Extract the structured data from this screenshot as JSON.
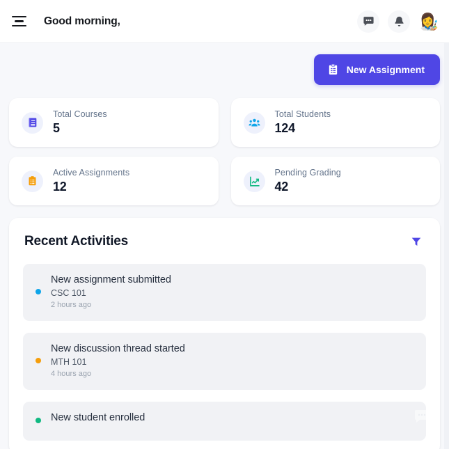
{
  "topbar": {
    "menu_icon": "hamburger-icon",
    "greeting": "Good morning,",
    "messages_icon": "chat-bubble-icon",
    "notifications_icon": "bell-icon",
    "avatar_emoji": "👩‍🎨"
  },
  "toolbar": {
    "new_assignment_label": "New Assignment",
    "new_assignment_icon": "clipboard-icon",
    "accent_color": "#4f46e5"
  },
  "stats": [
    {
      "label": "Total Courses",
      "value": "5",
      "icon": "book-icon",
      "icon_color": "#4f46e5"
    },
    {
      "label": "Total Students",
      "value": "124",
      "icon": "users-icon",
      "icon_color": "#0ea5e9"
    },
    {
      "label": "Active Assignments",
      "value": "12",
      "icon": "clipboard-list-icon",
      "icon_color": "#f59e0b"
    },
    {
      "label": "Pending Grading",
      "value": "42",
      "icon": "chart-line-icon",
      "icon_color": "#10b981"
    }
  ],
  "activities_panel": {
    "title": "Recent Activities",
    "filter_icon": "filter-icon",
    "filter_color": "#4f46e5",
    "items": [
      {
        "title": "New assignment submitted",
        "course": "CSC 101",
        "time": "2 hours ago",
        "dot_color": "#0ea5e9"
      },
      {
        "title": "New discussion thread started",
        "course": "MTH 101",
        "time": "4 hours ago",
        "dot_color": "#f59e0b"
      },
      {
        "title": "New student enrolled",
        "course": "",
        "time": "",
        "dot_color": "#10b981"
      }
    ]
  },
  "floating_action": {
    "icon": "chat-bubble-icon"
  }
}
